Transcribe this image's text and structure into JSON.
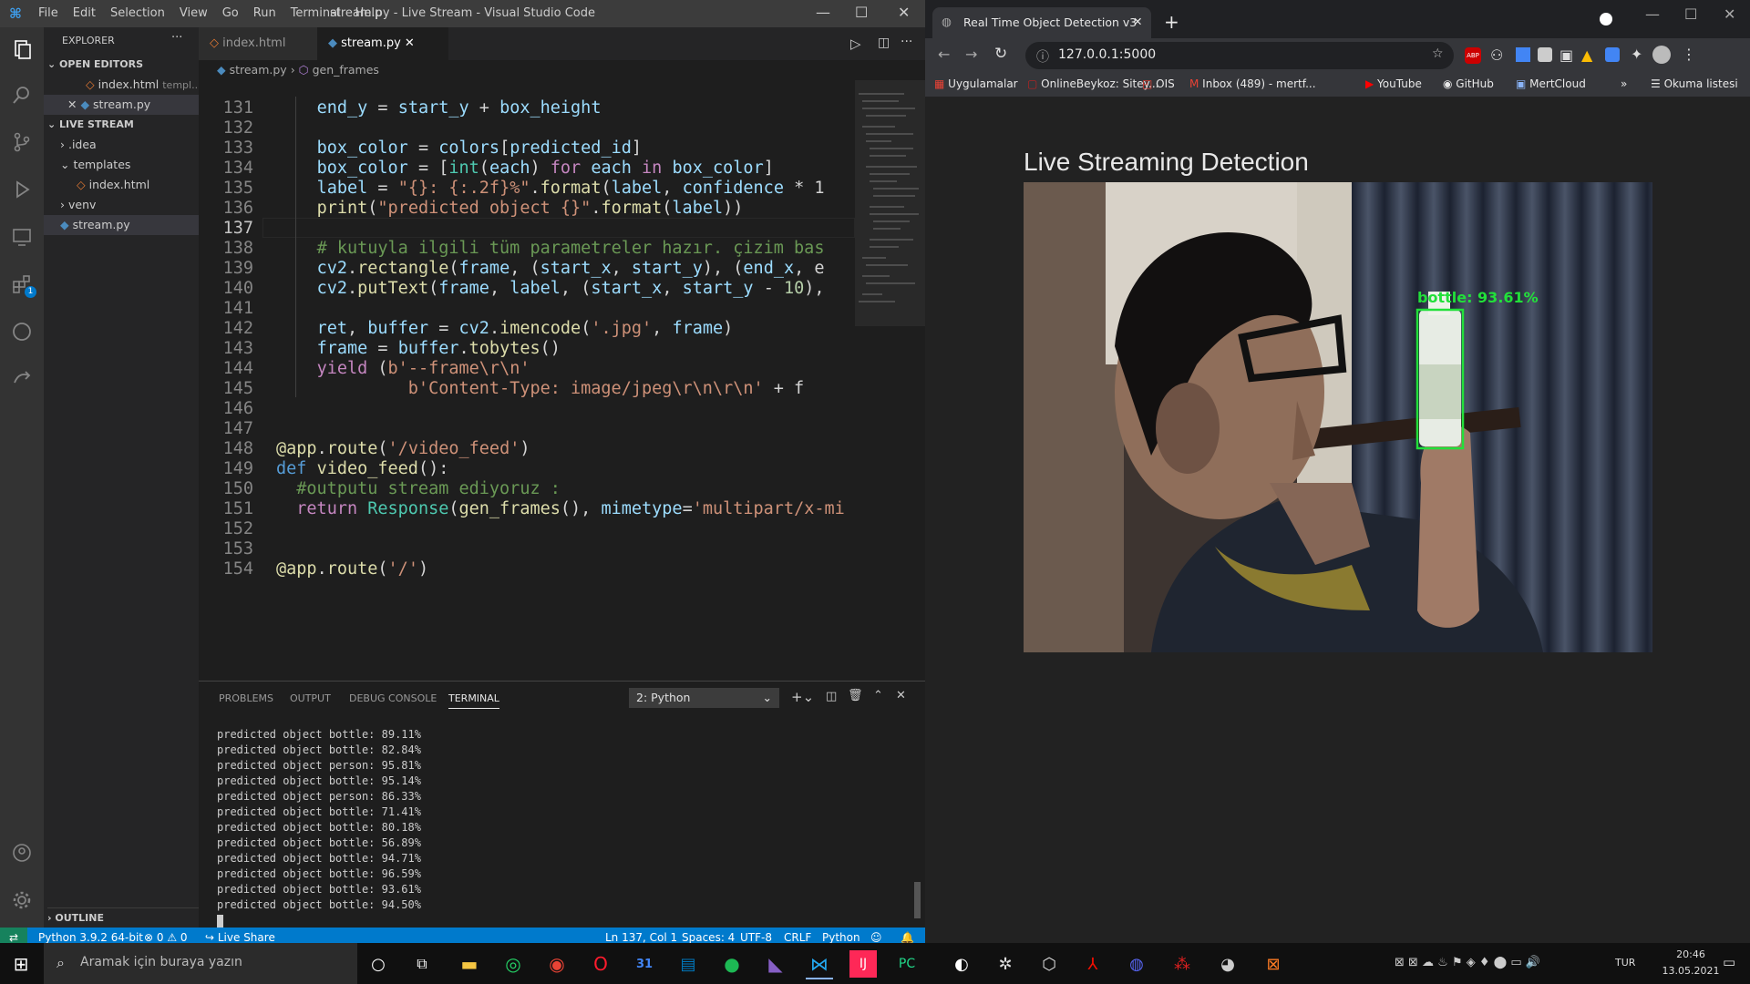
{
  "vscode": {
    "menu": [
      "File",
      "Edit",
      "Selection",
      "View",
      "Go",
      "Run",
      "Terminal",
      "Help"
    ],
    "window_title": "stream.py - Live Stream - Visual Studio Code",
    "explorer": {
      "header": "EXPLORER",
      "open_editors_label": "OPEN EDITORS",
      "open_editors": [
        {
          "name": "index.html",
          "detail": "templ..."
        },
        {
          "name": "stream.py",
          "detail": ""
        }
      ],
      "project_label": "LIVE STREAM",
      "tree": [
        {
          "name": ".idea",
          "type": "folder"
        },
        {
          "name": "templates",
          "type": "folder"
        },
        {
          "name": "index.html",
          "type": "file"
        },
        {
          "name": "venv",
          "type": "folder"
        },
        {
          "name": "stream.py",
          "type": "file"
        }
      ],
      "outline_label": "OUTLINE"
    },
    "tabs": [
      {
        "label": "index.html"
      },
      {
        "label": "stream.py"
      }
    ],
    "breadcrumb": {
      "file": "stream.py",
      "symbol": "gen_frames"
    },
    "code_lines": [
      {
        "n": "131"
      },
      {
        "n": "132"
      },
      {
        "n": "133"
      },
      {
        "n": "134"
      },
      {
        "n": "135"
      },
      {
        "n": "136"
      },
      {
        "n": "137"
      },
      {
        "n": "138"
      },
      {
        "n": "139"
      },
      {
        "n": "140"
      },
      {
        "n": "141"
      },
      {
        "n": "142"
      },
      {
        "n": "143"
      },
      {
        "n": "144"
      },
      {
        "n": "145"
      },
      {
        "n": "146"
      },
      {
        "n": "147"
      },
      {
        "n": "148"
      },
      {
        "n": "149"
      },
      {
        "n": "150"
      },
      {
        "n": "151"
      },
      {
        "n": "152"
      },
      {
        "n": "153"
      },
      {
        "n": "154"
      }
    ],
    "code_tokens": {
      "l131": [
        "end_y",
        " = ",
        "start_y",
        " + ",
        "box_height"
      ],
      "l133": [
        "box_color",
        " = ",
        "colors",
        "[",
        "predicted_id",
        "]"
      ],
      "l134": [
        "box_color",
        " = [",
        "int",
        "(",
        "each",
        ") ",
        "for",
        " ",
        "each",
        " ",
        "in",
        " ",
        "box_color",
        "]"
      ],
      "l135": [
        "label",
        " = ",
        "\"{}: {:.2f}%\"",
        ".",
        "format",
        "(",
        "label",
        ", ",
        "confidence",
        " * 1"
      ],
      "l136": [
        "print",
        "(",
        "\"predicted object {}\"",
        ".",
        "format",
        "(",
        "label",
        "))"
      ],
      "l138": [
        "# kutuyla ilgili tüm parametreler hazır. çizim bas"
      ],
      "l139": [
        "cv2",
        ".",
        "rectangle",
        "(",
        "frame",
        ", (",
        "start_x",
        ", ",
        "start_y",
        "), (",
        "end_x",
        ", e"
      ],
      "l140": [
        "cv2",
        ".",
        "putText",
        "(",
        "frame",
        ", ",
        "label",
        ", (",
        "start_x",
        ", ",
        "start_y",
        " - ",
        "10",
        "),"
      ],
      "l142": [
        "ret",
        ", ",
        "buffer",
        " = ",
        "cv2",
        ".",
        "imencode",
        "(",
        "'.jpg'",
        ", ",
        "frame",
        ")"
      ],
      "l143": [
        "frame",
        " = ",
        "buffer",
        ".",
        "tobytes",
        "()"
      ],
      "l144": [
        "yield",
        " (",
        "b'--frame\\r\\n'"
      ],
      "l145": [
        "b'Content-Type: image/jpeg\\r\\n\\r\\n'",
        " + f"
      ],
      "l148": [
        "@app",
        ".",
        "route",
        "(",
        "'/video_feed'",
        ")"
      ],
      "l149": [
        "def",
        " ",
        "video_feed",
        "():"
      ],
      "l150": [
        "#outputu stream ediyoruz :"
      ],
      "l151": [
        "return",
        " ",
        "Response",
        "(",
        "gen_frames",
        "(), ",
        "mimetype",
        "=",
        "'multipart/x-mi"
      ],
      "l154": [
        "@app",
        ".",
        "route",
        "(",
        "'/'",
        ")"
      ]
    },
    "panel": {
      "tabs": [
        "PROBLEMS",
        "OUTPUT",
        "DEBUG CONSOLE",
        "TERMINAL"
      ],
      "terminal_select": "2: Python",
      "terminal_lines": [
        "predicted object bottle: 89.11%",
        "predicted object bottle: 82.84%",
        "predicted object person: 95.81%",
        "predicted object bottle: 95.14%",
        "predicted object person: 86.33%",
        "predicted object bottle: 71.41%",
        "predicted object bottle: 80.18%",
        "predicted object bottle: 56.89%",
        "predicted object bottle: 94.71%",
        "predicted object bottle: 96.59%",
        "predicted object bottle: 93.61%",
        "predicted object bottle: 94.50%"
      ]
    },
    "status": {
      "python": "Python 3.9.2 64-bit",
      "errors": "0",
      "warnings": "0",
      "liveshare": "Live Share",
      "position": "Ln 137, Col 1",
      "spaces": "Spaces: 4",
      "encoding": "UTF-8",
      "eol": "CRLF",
      "language": "Python"
    },
    "accent": "#007acc"
  },
  "chrome": {
    "tab_title": "Real Time Object Detection v3",
    "url": "127.0.0.1:5000",
    "bookmarks": [
      "Uygulamalar",
      "OnlineBeykoz: Sitey...",
      "OIS",
      "Inbox (489) - mertf...",
      "YouTube",
      "GitHub",
      "MertCloud"
    ],
    "reading_list": "Okuma listesi",
    "page_heading": "Live Streaming Detection",
    "detection_label": "bottle: 93.61%",
    "detection_color": "#22e03a"
  },
  "taskbar": {
    "search_placeholder": "Aramak için buraya yazın",
    "lang": "TUR",
    "time": "20:46",
    "date": "13.05.2021"
  }
}
